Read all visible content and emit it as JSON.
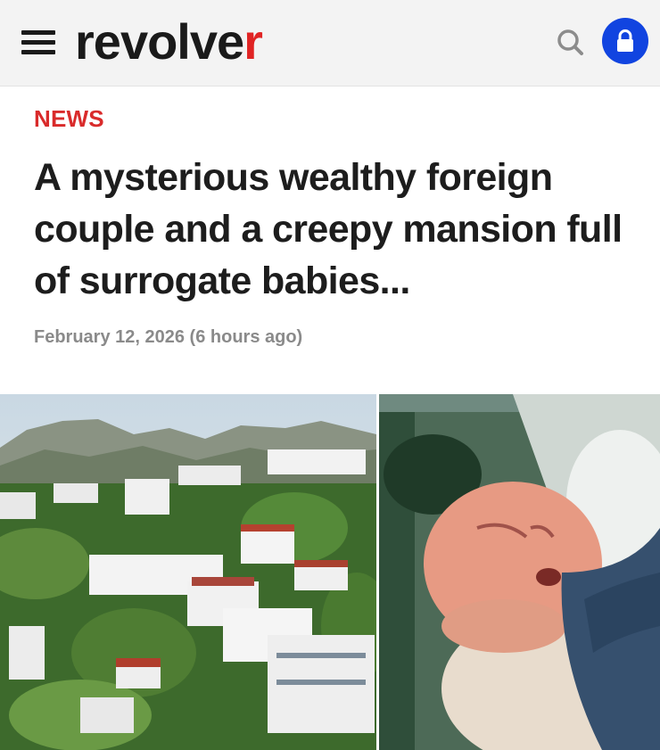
{
  "header": {
    "logo_main": "revolve",
    "logo_end": "r",
    "menu_icon": "hamburger-menu-icon",
    "search_icon": "search-icon",
    "account_icon": "lock-icon",
    "accent_color": "#e02424",
    "account_button_color": "#1144e0"
  },
  "article": {
    "category": "NEWS",
    "headline": "A mysterious wealthy foreign couple and a creepy mansion full of surrogate babies...",
    "dateline": "February 12, 2026 (6 hours ago)"
  }
}
